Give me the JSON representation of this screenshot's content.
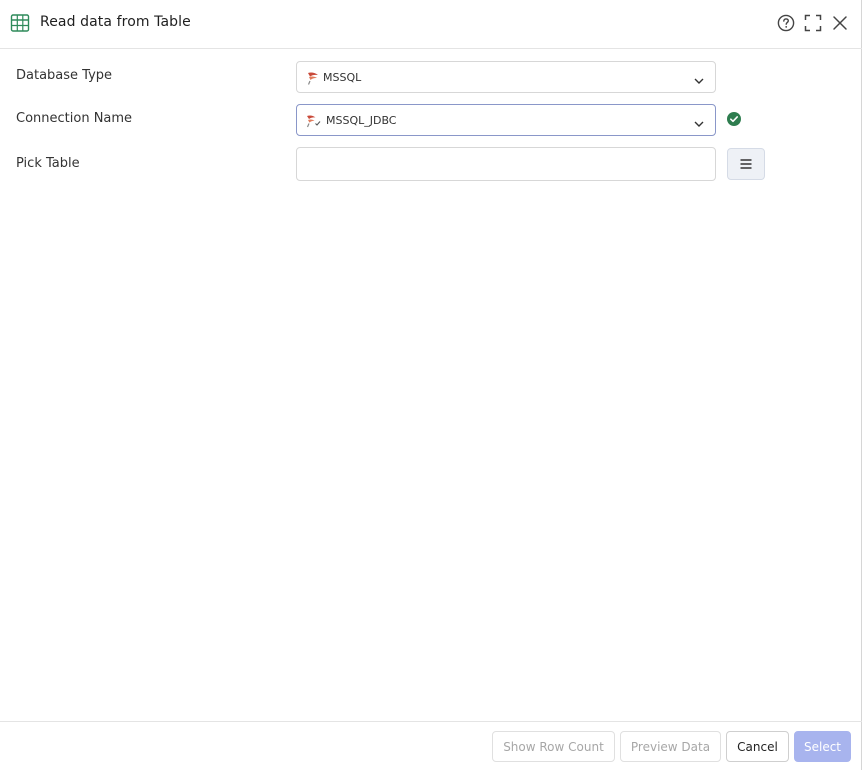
{
  "dialog": {
    "title": "Read data from Table",
    "header_icons": [
      "table-icon",
      "help-icon",
      "fullscreen-icon",
      "close-icon"
    ]
  },
  "form": {
    "database_type": {
      "label": "Database Type",
      "value": "MSSQL",
      "icon": "mssql-icon"
    },
    "connection_name": {
      "label": "Connection Name",
      "value": "MSSQL_JDBC",
      "icon": "mssql-connection-icon",
      "status": "connected"
    },
    "pick_table": {
      "label": "Pick Table",
      "value": "",
      "placeholder": ""
    }
  },
  "footer": {
    "show_row_count": "Show Row Count",
    "preview_data": "Preview Data",
    "cancel": "Cancel",
    "select": "Select"
  },
  "colors": {
    "accent": "#2e7d4f",
    "primary_button": "#a8b4ee",
    "success": "#2e7d4f",
    "mssql_red": "#c94a3a"
  }
}
